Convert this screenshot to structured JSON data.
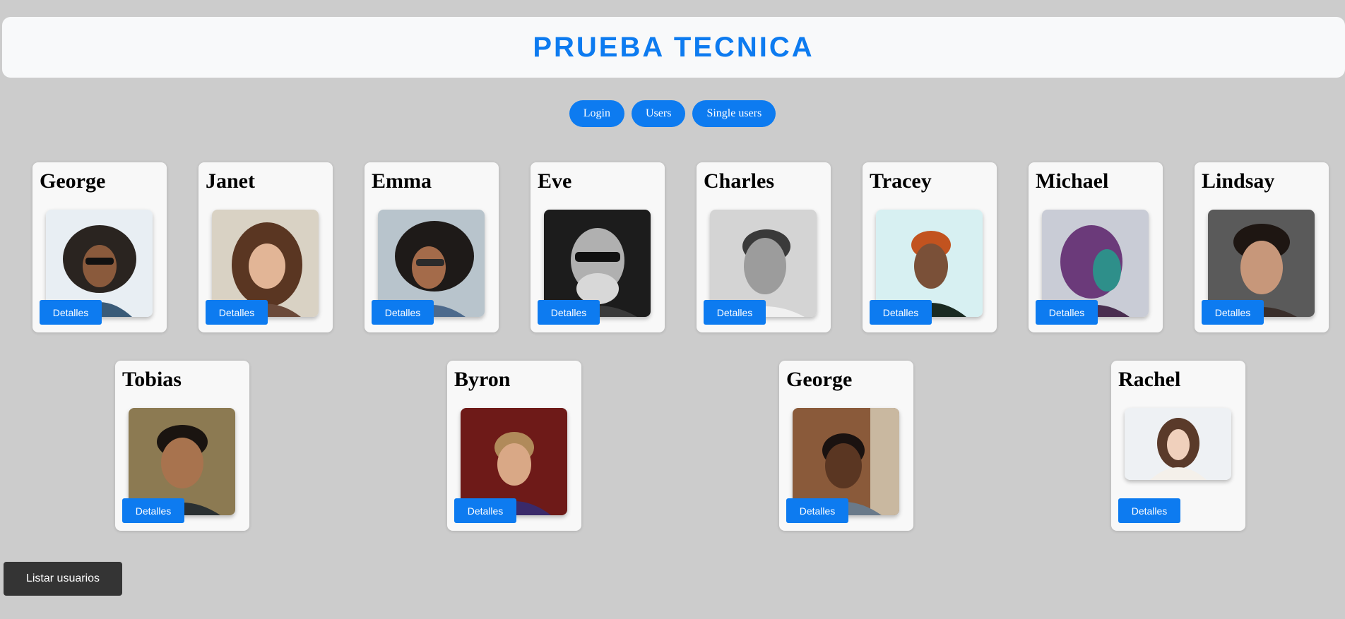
{
  "header": {
    "title": "PRUEBA TECNICA"
  },
  "nav": {
    "login": "Login",
    "users": "Users",
    "single_users": "Single users"
  },
  "colors": {
    "accent": "#0d7bf0",
    "background": "#cccccc",
    "dark_button": "#343434"
  },
  "users": [
    {
      "name": "George",
      "button": "Detalles"
    },
    {
      "name": "Janet",
      "button": "Detalles"
    },
    {
      "name": "Emma",
      "button": "Detalles"
    },
    {
      "name": "Eve",
      "button": "Detalles"
    },
    {
      "name": "Charles",
      "button": "Detalles"
    },
    {
      "name": "Tracey",
      "button": "Detalles"
    },
    {
      "name": "Michael",
      "button": "Detalles"
    },
    {
      "name": "Lindsay",
      "button": "Detalles"
    },
    {
      "name": "Tobias",
      "button": "Detalles"
    },
    {
      "name": "Byron",
      "button": "Detalles"
    },
    {
      "name": "George",
      "button": "Detalles"
    },
    {
      "name": "Rachel",
      "button": "Detalles"
    }
  ],
  "footer": {
    "list_button": "Listar usuarios"
  }
}
